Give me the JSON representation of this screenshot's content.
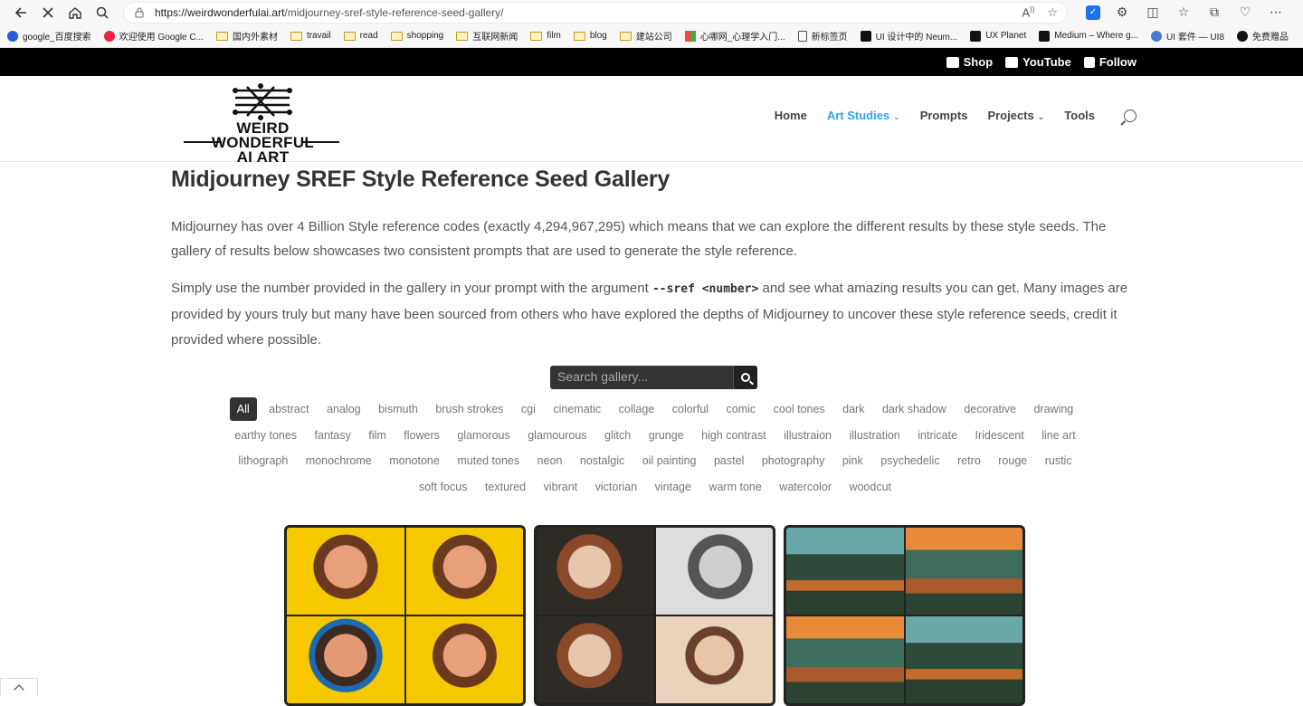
{
  "browser": {
    "url_host": "https://weirdwonderfulai.art",
    "url_path": "/midjourney-sref-style-reference-seed-gallery/",
    "bookmarks": [
      {
        "label": "google_百度搜索",
        "icon": "baidu-icon"
      },
      {
        "label": "欢迎使用 Google C...",
        "icon": "chrome-icon"
      },
      {
        "label": "国内外素材",
        "icon": "folder-icon"
      },
      {
        "label": "travail",
        "icon": "folder-icon"
      },
      {
        "label": "read",
        "icon": "folder-icon"
      },
      {
        "label": "shopping",
        "icon": "folder-icon"
      },
      {
        "label": "互联网新闻",
        "icon": "folder-icon"
      },
      {
        "label": "film",
        "icon": "folder-icon"
      },
      {
        "label": "blog",
        "icon": "folder-icon"
      },
      {
        "label": "建站公司",
        "icon": "folder-icon"
      },
      {
        "label": "心哪网_心理学入门...",
        "icon": "multi-icon"
      },
      {
        "label": "新标签页",
        "icon": "doc-icon"
      },
      {
        "label": "UI 设计中的 Neum...",
        "icon": "medium-icon"
      },
      {
        "label": "UX Planet",
        "icon": "medium-icon"
      },
      {
        "label": "Medium – Where g...",
        "icon": "medium-icon"
      },
      {
        "label": "UI 套件 — UI8",
        "icon": "ui8-icon"
      },
      {
        "label": "免费赠品",
        "icon": "v-icon"
      }
    ]
  },
  "topbar": {
    "shop": "Shop",
    "youtube": "YouTube",
    "follow": "Follow"
  },
  "logo": {
    "line1": "WEIRD WONDERFUL",
    "line2": "AI ART"
  },
  "nav": {
    "home": "Home",
    "art_studies": "Art Studies",
    "prompts": "Prompts",
    "projects": "Projects",
    "tools": "Tools"
  },
  "page": {
    "title": "Midjourney SREF Style Reference Seed Gallery",
    "para1": "Midjourney has over 4 Billion Style reference codes (exactly 4,294,967,295) which means that we can explore the different results by these style seeds. The gallery of results below showcases two consistent prompts that are used to generate the style reference.",
    "para2_a": "Simply use the number provided in the gallery in your prompt with the argument ",
    "para2_code": "--sref <number>",
    "para2_b": " and see what amazing results you can get. Many images are provided by yours truly but many have been sourced from others who have explored the depths of Midjourney to uncover these style reference seeds, credit it provided where possible."
  },
  "gallery": {
    "search_placeholder": "Search gallery...",
    "tags": [
      "All",
      "abstract",
      "analog",
      "bismuth",
      "brush strokes",
      "cgi",
      "cinematic",
      "collage",
      "colorful",
      "comic",
      "cool tones",
      "dark",
      "dark shadow",
      "decorative",
      "drawing",
      "earthy tones",
      "fantasy",
      "film",
      "flowers",
      "glamorous",
      "glamourous",
      "glitch",
      "grunge",
      "high contrast",
      "illustraion",
      "illustration",
      "intricate",
      "Iridescent",
      "line art",
      "lithograph",
      "monochrome",
      "monotone",
      "muted tones",
      "neon",
      "nostalgic",
      "oil painting",
      "pastel",
      "photography",
      "pink",
      "psychedelic",
      "retro",
      "rouge",
      "rustic",
      "soft focus",
      "textured",
      "vibrant",
      "victorian",
      "vintage",
      "warm tone",
      "watercolor",
      "woodcut"
    ],
    "active_tag": "All"
  },
  "colors": {
    "accent": "#2ea3f2",
    "topbar": "#000000",
    "search_bg": "#333333"
  }
}
